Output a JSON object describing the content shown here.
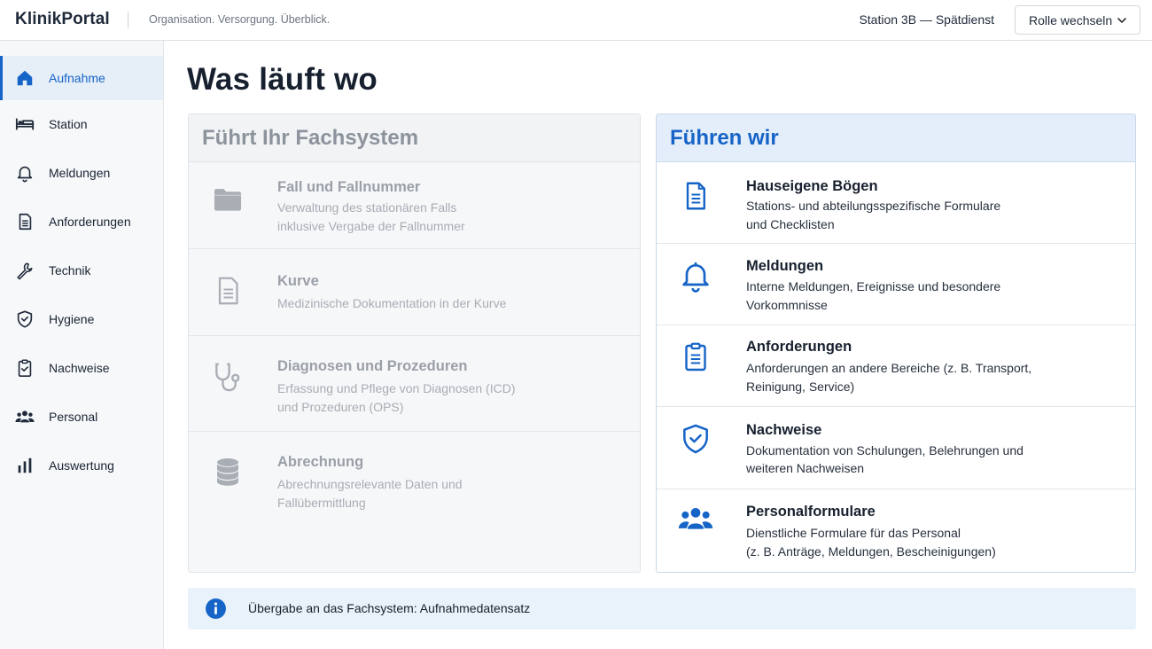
{
  "header": {
    "logo": "KlinikPortal",
    "tagline": "Organisation. Versorgung. Überblick.",
    "station": "Station 3B — Spätdienst",
    "role_button": "Rolle wechseln"
  },
  "sidebar": {
    "items": [
      {
        "label": "Aufnahme",
        "icon": "home-icon",
        "active": true
      },
      {
        "label": "Station",
        "icon": "bed-icon",
        "active": false
      },
      {
        "label": "Meldungen",
        "icon": "bell-icon",
        "active": false
      },
      {
        "label": "Anforderungen",
        "icon": "document-icon",
        "active": false
      },
      {
        "label": "Technik",
        "icon": "wrench-icon",
        "active": false
      },
      {
        "label": "Hygiene",
        "icon": "shield-check-icon",
        "active": false
      },
      {
        "label": "Nachweise",
        "icon": "clipboard-check-icon",
        "active": false
      },
      {
        "label": "Personal",
        "icon": "people-icon",
        "active": false
      },
      {
        "label": "Auswertung",
        "icon": "bar-chart-icon",
        "active": false
      }
    ]
  },
  "main": {
    "title": "Was läuft wo",
    "left_panel": {
      "title": "Führt Ihr Fachsystem",
      "items": [
        {
          "title": "Fall und Fallnummer",
          "desc1": "Verwaltung des stationären Falls",
          "desc2": "inklusive Vergabe der Fallnummer",
          "icon": "folder-icon"
        },
        {
          "title": "Kurve",
          "desc1": "Medizinische Dokumentation in der Kurve",
          "desc2": "",
          "icon": "document-icon"
        },
        {
          "title": "Diagnosen und Prozeduren",
          "desc1": "Erfassung und Pflege von Diagnosen (ICD)",
          "desc2": "und Prozeduren (OPS)",
          "icon": "stethoscope-icon"
        },
        {
          "title": "Abrechnung",
          "desc1": "Abrechnungsrelevante Daten und",
          "desc2": "Fallübermittlung",
          "icon": "database-icon"
        }
      ]
    },
    "right_panel": {
      "title": "Führen wir",
      "items": [
        {
          "title": "Hauseigene Bögen",
          "desc1": "Stations- und abteilungsspezifische Formulare",
          "desc2": "und Checklisten",
          "icon": "document-icon"
        },
        {
          "title": "Meldungen",
          "desc1": "Interne Meldungen, Ereignisse und besondere",
          "desc2": "Vorkommnisse",
          "icon": "bell-icon"
        },
        {
          "title": "Anforderungen",
          "desc1": "Anforderungen an andere Bereiche (z. B. Transport,",
          "desc2": "Reinigung, Service)",
          "icon": "clipboard-icon"
        },
        {
          "title": "Nachweise",
          "desc1": "Dokumentation von Schulungen, Belehrungen und",
          "desc2": "weiteren Nachweisen",
          "icon": "shield-check-icon"
        },
        {
          "title": "Personalformulare",
          "desc1": "Dienstliche Formulare für das Personal",
          "desc2": "(z. B. Anträge, Meldungen, Bescheinigungen)",
          "icon": "people-icon"
        }
      ]
    },
    "info": {
      "text": "Übergabe an das Fachsystem: Aufnahmedatensatz",
      "icon": "info-icon"
    }
  },
  "colors": {
    "accent": "#1664c7",
    "muted": "#9aa0a8",
    "info_bg": "#e9f1fa"
  }
}
